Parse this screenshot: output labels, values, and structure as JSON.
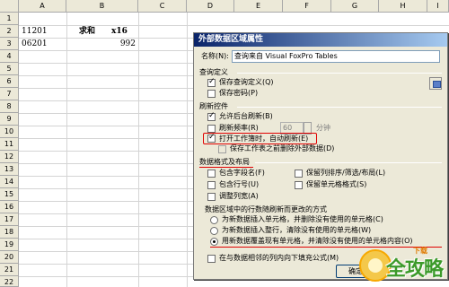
{
  "sheet": {
    "columns": [
      "A",
      "B",
      "C",
      "D",
      "E",
      "F",
      "G",
      "H",
      "I"
    ],
    "rows": [
      "1",
      "2",
      "3",
      "4",
      "5",
      "6",
      "7",
      "8",
      "9",
      "10",
      "11",
      "12",
      "13",
      "14",
      "15",
      "16",
      "17",
      "18",
      "19",
      "20",
      "21",
      "22"
    ],
    "a2": "11201",
    "b2_label": "求和",
    "b2_value": "x16",
    "a3": "06201",
    "b3": "992"
  },
  "dialog": {
    "title": "外部数据区域属性",
    "name_label": "名称(N):",
    "name_value": "查询来自 Visual FoxPro Tables",
    "query_def_group": "查询定义",
    "save_query_def": "保存查询定义(Q)",
    "save_password": "保存密码(P)",
    "refresh_group": "刷新控件",
    "background_refresh": "允许后台刷新(B)",
    "refresh_interval": "刷新频率(R)",
    "refresh_minutes_value": "60",
    "minutes_unit": "分钟",
    "refresh_on_open": "打开工作簿时，自动刷新(E)",
    "remove_external_data": "保存工作表之前删除外部数据(D)",
    "format_group": "数据格式及布局",
    "include_field_names": "包含字段名(F)",
    "include_row_numbers": "包含行号(U)",
    "adjust_column_width": "调整列宽(A)",
    "preserve_sort": "保留列排序/筛选/布局(L)",
    "preserve_cell_format": "保留单元格格式(S)",
    "rows_change_label": "数据区域中的行数随刷新而更改的方式",
    "insert_cells": "为新数据插入单元格，并删除没有使用的单元格(C)",
    "insert_rows": "为新数据插入整行，清除没有使用的单元格(W)",
    "overwrite_cells": "用新数据覆盖现有单元格，并清除没有使用的单元格内容(O)",
    "fill_down_formulas": "在与数据相邻的列内向下填充公式(M)",
    "ok_button": "确定"
  },
  "watermark": {
    "logo_text": "全攻略",
    "small_text": "下载"
  },
  "colors": {
    "title_bar": "#0a246a",
    "highlight": "#e00000",
    "watermark_green": "#3c9a2a"
  }
}
